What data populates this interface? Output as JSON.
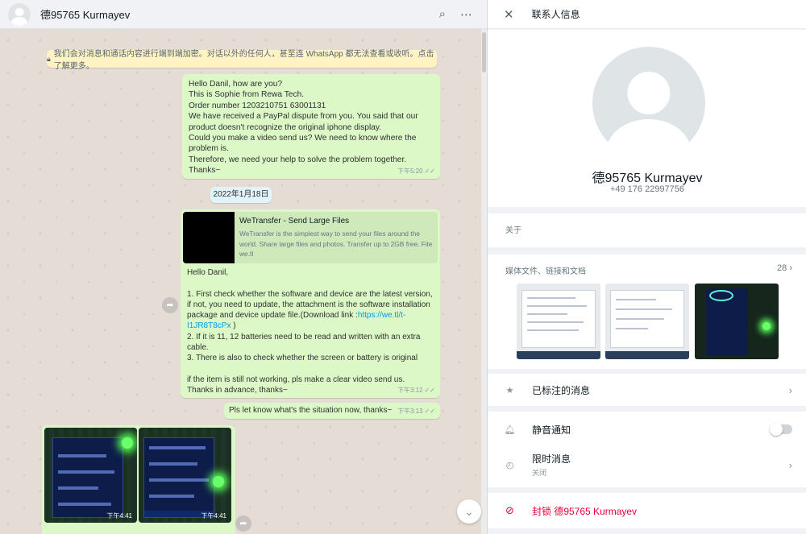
{
  "colors": {
    "chat_bg": "#e5ddd5",
    "outgoing_bubble": "#dcf8c6",
    "danger": "#ea0038",
    "link": "#039be5"
  },
  "chat": {
    "contact_name": "德95765 Kurmayev",
    "icons": [
      "search-icon",
      "menu-icon"
    ],
    "encryption_notice": "我们会对消息和通话内容进行端到端加密。对话以外的任何人，甚至连 WhatsApp 都无法查看或收听。点击了解更多。",
    "messages": [
      {
        "text": "Hello Danil, how are you?\nThis is Sophie from Rewa Tech.\nOrder number 1203210751 63001131\nWe have received a PayPal dispute from you. You said that our product doesn't recognize the original iphone display.\nCould you make a video send us? We need to know where the problem is.\nTherefore, we need your help to solve the problem together.\nThanks~",
        "time": "下午5:20"
      }
    ],
    "date_chip": "2022年1月18日",
    "link_message": {
      "preview_title": "WeTransfer - Send Large Files",
      "preview_desc": "WeTransfer is the simplest way to send your files around the world. Share large files and photos. Transfer up to 2GB free. File we.tl",
      "text_before": "Hello Danil,\n\n 1. First check whether the software and device are the latest version, if not, you need to update, the attachment is the software installation package and device update file.(Download link  :",
      "link_text": "https://we.tl/t-I1JR8T8cPx",
      "text_after": " )\n 2. If it is 11, 12 batteries need to be read and written with an extra cable.\n 3. There is also to check whether the screen or battery is original\n\n if the item is still not working, pls make a clear video send us.\n Thanks in advance, thanks~",
      "time": "下午3:12"
    },
    "short_message": {
      "text": "Pls let know what's the situation now, thanks~",
      "time": "下午3:13"
    },
    "images": [
      {
        "time": "下午4:41"
      },
      {
        "time": "下午4:41"
      }
    ]
  },
  "info": {
    "header_title": "联系人信息",
    "name": "德95765 Kurmayev",
    "phone": "+49 176 22997756",
    "about_label": "关于",
    "media_label": "媒体文件、链接和文档",
    "media_count": "28",
    "starred_label": "已标注的消息",
    "mute_label": "静音通知",
    "mute_on": false,
    "disappearing_label": "限时消息",
    "disappearing_value": "关闭",
    "block_label": "封锁 德95765 Kurmayev"
  }
}
